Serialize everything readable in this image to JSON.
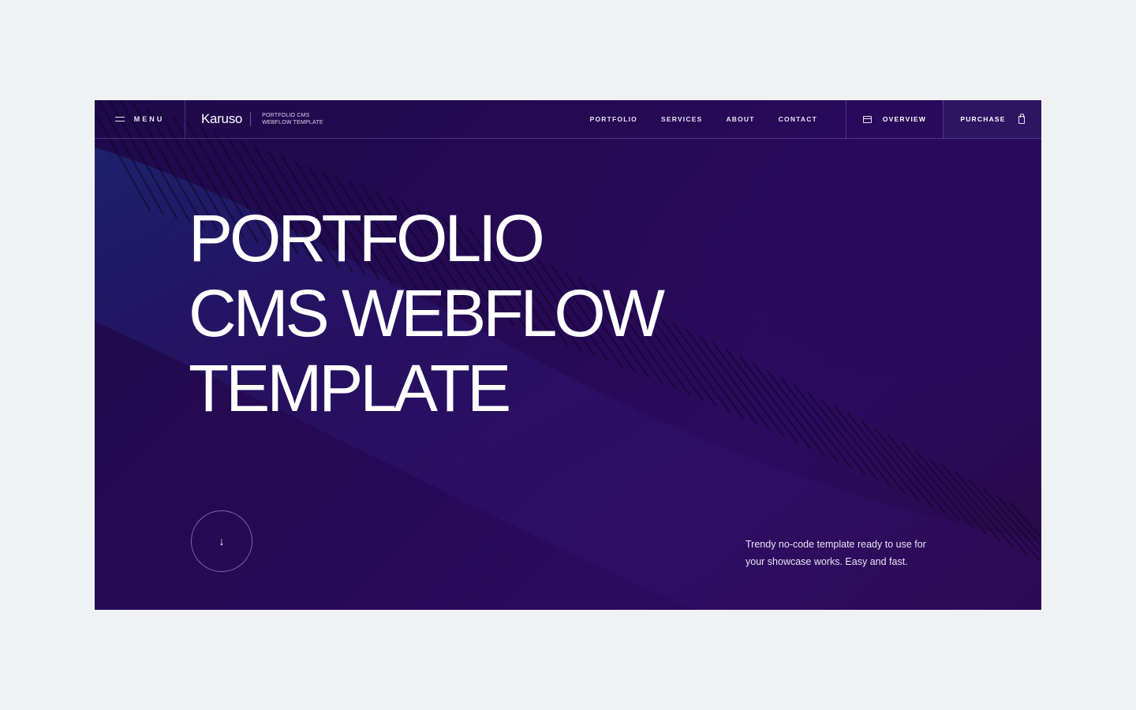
{
  "nav": {
    "menu_label": "MENU",
    "logo": "Karuso",
    "tagline_line1": "PORTFOLIO CMS",
    "tagline_line2": "WEBFLOW TEMPLATE",
    "links": [
      "PORTFOLIO",
      "SERVICES",
      "ABOUT",
      "CONTACT"
    ],
    "overview_label": "OVERVIEW",
    "purchase_label": "PURCHASE"
  },
  "hero": {
    "title_line1": "PORTFOLIO",
    "title_line2": "CMS WEBFLOW",
    "title_line3": "TEMPLATE",
    "scroll_icon": "↓",
    "description": "Trendy no-code template ready to use for your showcase works. Easy and fast."
  },
  "colors": {
    "page_bg": "#f0f1f5",
    "hero_bg": "#260a55",
    "purchase_bg": "#2e1562",
    "text": "#ffffff"
  },
  "icons": {
    "menu": "hamburger-icon",
    "overview": "card-icon",
    "purchase": "bag-icon",
    "scroll": "arrow-down-icon"
  }
}
